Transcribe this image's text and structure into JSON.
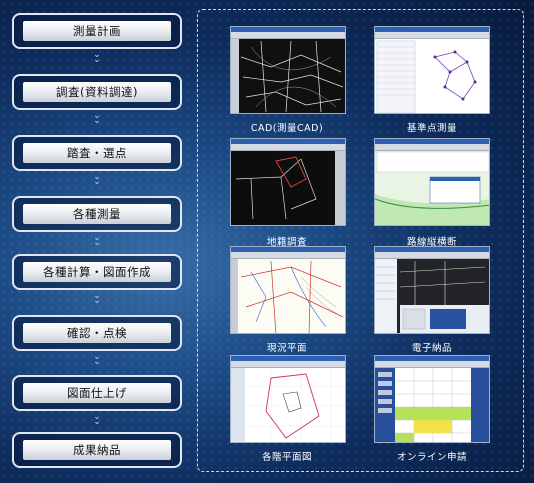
{
  "steps": [
    {
      "label": "測量計画"
    },
    {
      "label": "調査(資料調達)"
    },
    {
      "label": "踏査・選点"
    },
    {
      "label": "各種測量"
    },
    {
      "label": "各種計算・図面作成"
    },
    {
      "label": "確認・点検"
    },
    {
      "label": "図面仕上げ"
    },
    {
      "label": "成果納品"
    }
  ],
  "chevron": "⌄⌄",
  "screens": [
    {
      "caption": "CAD(測量CAD)"
    },
    {
      "caption": "基準点測量"
    },
    {
      "caption": "地籍調査"
    },
    {
      "caption": "路線縦横断"
    },
    {
      "caption": "現況平面"
    },
    {
      "caption": "電子納品"
    },
    {
      "caption": "各階平面図"
    },
    {
      "caption": "オンライン申請"
    }
  ]
}
